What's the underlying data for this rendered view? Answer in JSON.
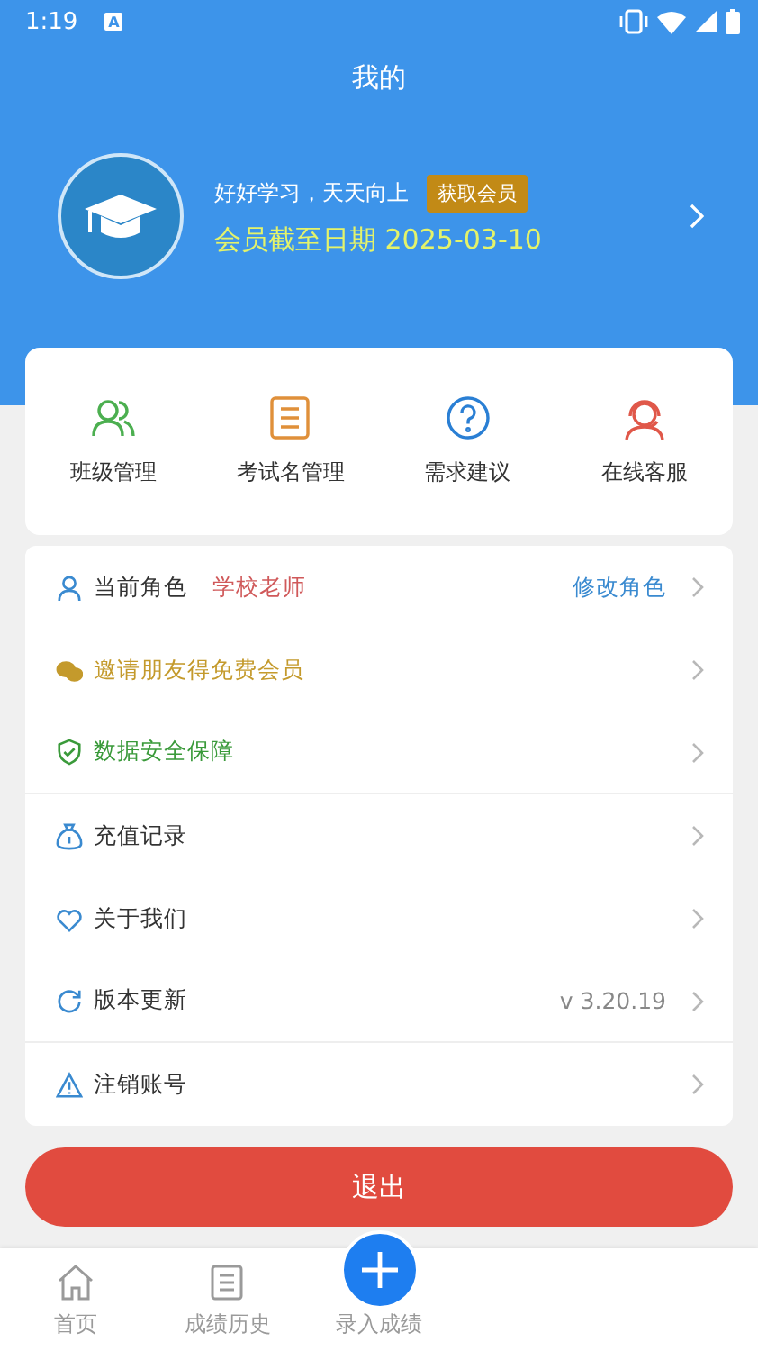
{
  "status_bar": {
    "time": "1:19",
    "notification_glyph": "A"
  },
  "header": {
    "title": "我的"
  },
  "profile": {
    "motto": "好好学习，天天向上",
    "badge": "获取会员",
    "expiry": "会员截至日期 2025-03-10"
  },
  "shortcuts": [
    {
      "kind": "people",
      "label": "班级管理",
      "color": "#4caf50"
    },
    {
      "kind": "list",
      "label": "考试名管理",
      "color": "#e0903a"
    },
    {
      "kind": "question",
      "label": "需求建议",
      "color": "#2a7fd4"
    },
    {
      "kind": "headset",
      "label": "在线客服",
      "color": "#e0584a"
    }
  ],
  "menu": [
    {
      "kind": "person",
      "label": "当前角色",
      "color": "#333333",
      "value": "学校老师",
      "action": "修改角色",
      "divider": false
    },
    {
      "kind": "chat",
      "label": "邀请朋友得免费会员",
      "color": "#c49a2c",
      "divider": false
    },
    {
      "kind": "shield",
      "label": "数据安全保障",
      "color": "#3a9a3a",
      "divider": true
    },
    {
      "kind": "moneybag",
      "label": "充值记录",
      "color": "#333333",
      "divider": false
    },
    {
      "kind": "heart",
      "label": "关于我们",
      "color": "#333333",
      "divider": false
    },
    {
      "kind": "refresh",
      "label": "版本更新",
      "color": "#333333",
      "version": "v 3.20.19",
      "divider": true
    },
    {
      "kind": "warning",
      "label": "注销账号",
      "color": "#333333",
      "divider": false
    }
  ],
  "logout_button": "退出",
  "tabs": [
    {
      "kind": "home",
      "label": "首页",
      "selected": false
    },
    {
      "kind": "list",
      "label": "成绩历史",
      "selected": false
    },
    {
      "kind": "plus",
      "label": "录入成绩",
      "selected": false
    }
  ]
}
